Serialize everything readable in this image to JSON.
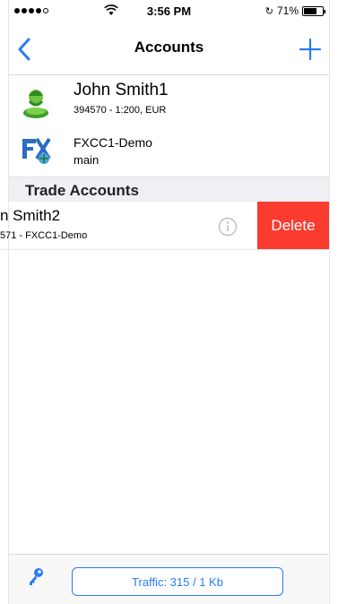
{
  "status_bar": {
    "time": "3:56 PM",
    "battery_text": "71%",
    "battery_level": 0.71,
    "signal_bars_filled": 4,
    "signal_bars_total": 5,
    "wifi_icon": "wifi-icon",
    "lock_icon": "rotation-lock-icon"
  },
  "navbar": {
    "title": "Accounts",
    "back_icon": "chevron-left-icon",
    "add_icon": "plus-icon"
  },
  "accounts": [
    {
      "name": "John Smith1",
      "details": "394570 - 1:200, EUR",
      "icon": "trader-avatar-icon"
    },
    {
      "name": "FXCC1-Demo",
      "details": "main",
      "icon": "broker-logo-icon"
    }
  ],
  "trade_accounts": {
    "header": "Trade Accounts",
    "rows": [
      {
        "name": "n Smith2",
        "details": "571 - FXCC1-Demo"
      }
    ]
  },
  "swipe_action": {
    "label": "Delete"
  },
  "toolbar": {
    "key_icon": "key-icon",
    "traffic_label": "Traffic: 315 / 1 Kb"
  },
  "colors": {
    "accent": "#2a7bf6",
    "delete": "#fb3b30",
    "section_bg": "#efeff4"
  }
}
